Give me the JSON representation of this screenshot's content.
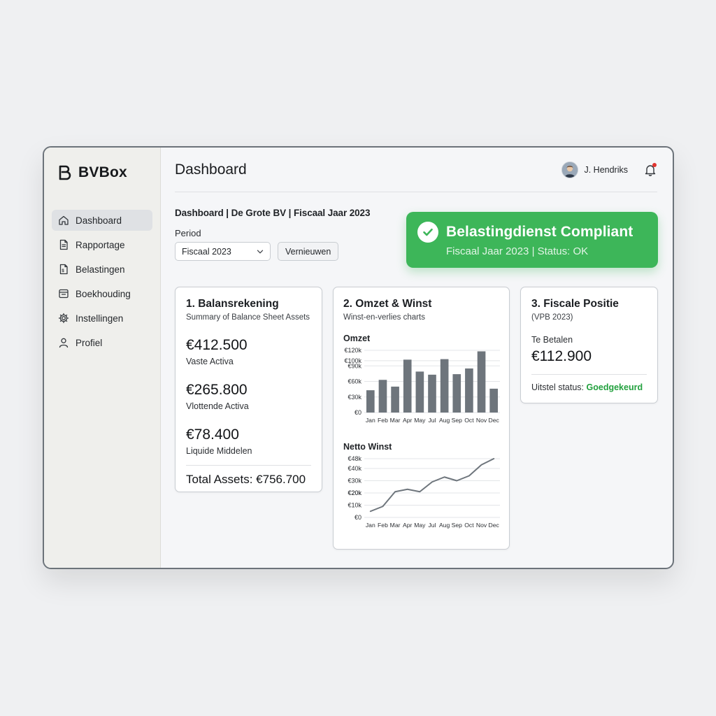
{
  "app": {
    "name": "BVBox"
  },
  "sidebar": {
    "items": [
      {
        "label": "Dashboard",
        "icon": "home-icon",
        "active": true
      },
      {
        "label": "Rapportage",
        "icon": "document-icon",
        "active": false
      },
      {
        "label": "Belastingen",
        "icon": "tax-file-icon",
        "active": false
      },
      {
        "label": "Boekhouding",
        "icon": "ledger-icon",
        "active": false
      },
      {
        "label": "Instellingen",
        "icon": "gear-icon",
        "active": false
      },
      {
        "label": "Profiel",
        "icon": "user-icon",
        "active": false
      }
    ]
  },
  "header": {
    "title": "Dashboard",
    "user_name": "J. Hendriks",
    "notification_dot": true
  },
  "main": {
    "breadcrumb": "Dashboard | De Grote BV | Fiscaal Jaar 2023",
    "period_label": "Period",
    "period_value": "Fiscaal 2023",
    "refresh_label": "Vernieuwen"
  },
  "compliance": {
    "title": "Belastingdienst Compliant",
    "subtitle": "Fiscaal Jaar 2023 | Status: OK",
    "color": "#3db659"
  },
  "balance_card": {
    "title": "1. Balansrekening",
    "subtitle": "Summary of Balance Sheet Assets",
    "items": [
      {
        "amount": "€412.500",
        "label": "Vaste Activa"
      },
      {
        "amount": "€265.800",
        "label": "Vlottende Activa"
      },
      {
        "amount": "€78.400",
        "label": "Liquide Middelen"
      }
    ],
    "total": "Total Assets: €756.700"
  },
  "omzet_card": {
    "title": "2. Omzet & Winst",
    "subtitle": "Winst-en-verlies charts"
  },
  "fiscal_card": {
    "title": "3. Fiscale Positie",
    "subtitle": "(VPB 2023)",
    "due_label": "Te Betalen",
    "due_amount": "€112.900",
    "deferral_label": "Uitstel status:",
    "deferral_value": "Goedgekeurd",
    "deferral_color": "#23a13f"
  },
  "chart_data": [
    {
      "type": "bar",
      "title": "Omzet",
      "categories": [
        "Jan",
        "Feb",
        "Mar",
        "Apr",
        "May",
        "Jul",
        "Aug",
        "Sep",
        "Oct",
        "Nov",
        "Dec"
      ],
      "values": [
        43000,
        63000,
        50000,
        102000,
        79000,
        73000,
        103000,
        74000,
        85000,
        118000,
        46000
      ],
      "y_ticks": [
        "€0",
        "€30k",
        "€60k",
        "€90k",
        "€100k",
        "€120k"
      ],
      "y_tick_values": [
        0,
        30000,
        60000,
        90000,
        100000,
        120000
      ],
      "ylim": [
        0,
        120000
      ],
      "grid": true,
      "color": "#6e757c"
    },
    {
      "type": "line",
      "title": "Netto Winst",
      "categories": [
        "Jan",
        "Feb",
        "Mar",
        "Apr",
        "May",
        "Jul",
        "Aug",
        "Sep",
        "Oct",
        "Nov",
        "Dec"
      ],
      "values": [
        5000,
        9000,
        21000,
        23000,
        21000,
        29000,
        33000,
        30000,
        34000,
        43000,
        48000
      ],
      "y_ticks": [
        "€0",
        "€10k",
        "€20k",
        "€20k",
        "€30k",
        "€40k",
        "€48k"
      ],
      "y_tick_values": [
        0,
        10000,
        20000,
        20000,
        30000,
        40000,
        48000
      ],
      "ylim": [
        0,
        48000
      ],
      "grid": true,
      "color": "#6e757c"
    }
  ]
}
